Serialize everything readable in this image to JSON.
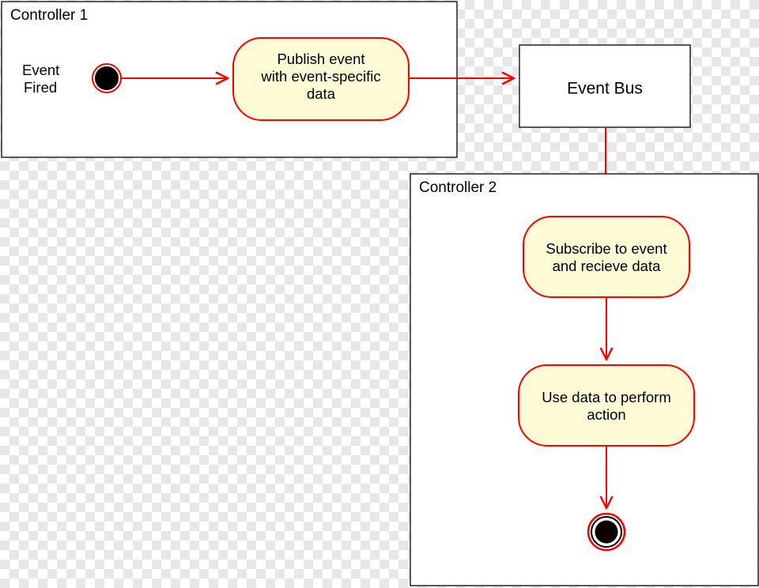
{
  "chart_data": {
    "type": "uml-activity",
    "swimlanes": [
      {
        "id": "controller1",
        "title": "Controller 1"
      },
      {
        "id": "eventbus",
        "title": "Event Bus"
      },
      {
        "id": "controller2",
        "title": "Controller 2"
      }
    ],
    "nodes": [
      {
        "id": "start",
        "lane": "controller1",
        "kind": "initial",
        "label": "Event Fired"
      },
      {
        "id": "publish",
        "lane": "controller1",
        "kind": "action",
        "label": "Publish event with event-specific data"
      },
      {
        "id": "bus",
        "lane": "eventbus",
        "kind": "object",
        "label": "Event Bus"
      },
      {
        "id": "subscribe",
        "lane": "controller2",
        "kind": "action",
        "label": "Subscribe to event and recieve data"
      },
      {
        "id": "use",
        "lane": "controller2",
        "kind": "action",
        "label": "Use data to perform action"
      },
      {
        "id": "end",
        "lane": "controller2",
        "kind": "final",
        "label": ""
      }
    ],
    "edges": [
      [
        "start",
        "publish"
      ],
      [
        "publish",
        "bus"
      ],
      [
        "bus",
        "subscribe"
      ],
      [
        "subscribe",
        "use"
      ],
      [
        "use",
        "end"
      ]
    ]
  },
  "labels": {
    "controller1": "Controller 1",
    "controller2": "Controller 2",
    "eventFiredL1": "Event",
    "eventFiredL2": "Fired",
    "publishL1": "Publish event",
    "publishL2": "with event-specific",
    "publishL3": "data",
    "eventBus": "Event Bus",
    "subscribeL1": "Subscribe to event",
    "subscribeL2": "and recieve data",
    "useL1": "Use data to perform",
    "useL2": "action"
  }
}
